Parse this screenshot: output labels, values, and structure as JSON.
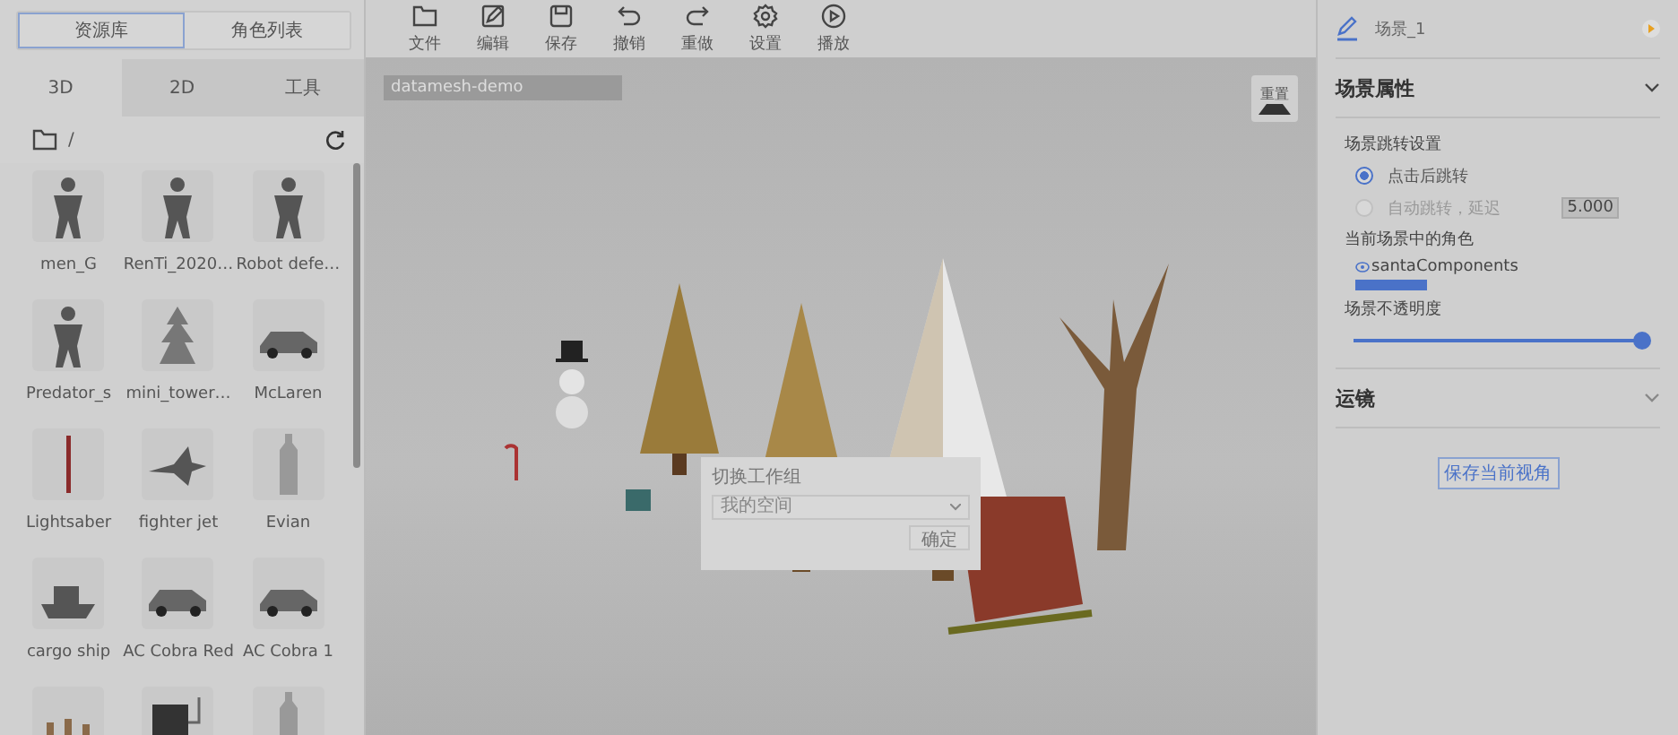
{
  "left_panel": {
    "tabs": [
      {
        "label": "资源库",
        "selected": true
      },
      {
        "label": "角色列表",
        "selected": false
      }
    ],
    "subtabs": [
      {
        "label": "3D",
        "selected": true
      },
      {
        "label": "2D",
        "selected": false
      },
      {
        "label": "工具",
        "selected": false
      }
    ],
    "path": "/",
    "assets": [
      {
        "kind": "figure",
        "label": "men_G"
      },
      {
        "kind": "figure",
        "label": "RenTi_2020…"
      },
      {
        "kind": "figure",
        "label": "Robot defe…"
      },
      {
        "kind": "figure",
        "label": "Predator_s"
      },
      {
        "kind": "tower",
        "label": "mini_tower…"
      },
      {
        "kind": "car",
        "label": "McLaren"
      },
      {
        "kind": "stick",
        "label": "Lightsaber"
      },
      {
        "kind": "jet",
        "label": "fighter jet"
      },
      {
        "kind": "bottle",
        "label": "Evian"
      },
      {
        "kind": "ship",
        "label": "cargo ship"
      },
      {
        "kind": "car",
        "label": "AC Cobra Red"
      },
      {
        "kind": "car",
        "label": "AC Cobra 1"
      },
      {
        "kind": "group"
      },
      {
        "kind": "machine"
      },
      {
        "kind": "bottle"
      }
    ]
  },
  "toolbar": [
    {
      "label": "文件"
    },
    {
      "label": "编辑"
    },
    {
      "label": "保存"
    },
    {
      "label": "撤销"
    },
    {
      "label": "重做"
    },
    {
      "label": "设置"
    },
    {
      "label": "播放"
    }
  ],
  "viewport": {
    "project": "datamesh-demo",
    "reset_label": "重置",
    "dialog": {
      "title": "切换工作组",
      "placeholder": "我的空间",
      "confirm": "确定"
    }
  },
  "right_panel": {
    "scene_name": "场景_1",
    "sections": [
      {
        "title": "场景属性",
        "expanded": true
      },
      {
        "title": "运镜",
        "expanded": false
      }
    ],
    "jump_title": "场景跳转设置",
    "jump_options": [
      {
        "label": "点击后跳转",
        "selected": true
      },
      {
        "label": "自动跳转，延迟",
        "selected": false
      }
    ],
    "delay": "5.000",
    "roles_title": "当前场景中的角色",
    "roles": [
      {
        "name": "santaComponents",
        "selected": true
      }
    ],
    "opacity_title": "场景不透明度",
    "opacity": {
      "level": 1.0
    },
    "save_button": "保存当前视角"
  }
}
